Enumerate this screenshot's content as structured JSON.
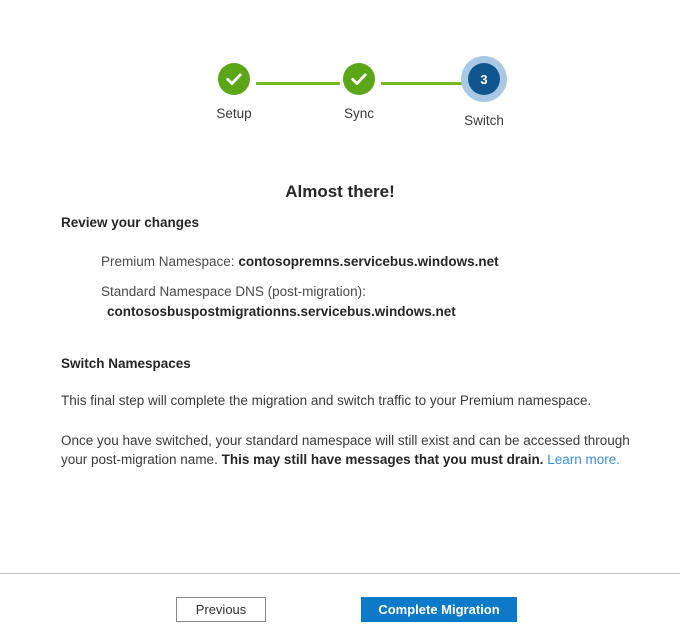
{
  "stepper": {
    "steps": [
      {
        "label": "Setup",
        "state": "done",
        "marker": "check-icon",
        "number": "1"
      },
      {
        "label": "Sync",
        "state": "done",
        "marker": "check-icon",
        "number": "2"
      },
      {
        "label": "Switch",
        "state": "current",
        "marker": "3",
        "number": "3"
      }
    ]
  },
  "main": {
    "title": "Almost there!",
    "review_heading": "Review your changes",
    "details": [
      {
        "key": "Premium Namespace:",
        "value": "contosopremns.servicebus.windows.net",
        "layout": "inline"
      },
      {
        "key": "Standard Namespace DNS (post-migration):",
        "value": "contososbuspostmigrationns.servicebus.windows.net",
        "layout": "block"
      }
    ],
    "switch_heading": "Switch Namespaces",
    "paragraph_one": "This final step will complete the migration and switch traffic to your Premium namespace.",
    "paragraph_two_prefix": "Once you have switched, your standard namespace will still exist and can be accessed through your post-migration name. ",
    "paragraph_two_bold": "This may still have messages that you must drain.",
    "paragraph_two_link": "Learn more."
  },
  "footer": {
    "previous_label": "Previous",
    "complete_label": "Complete Migration"
  },
  "colors": {
    "step_done": "#5ba617",
    "step_current": "#10558e",
    "step_current_ring": "#a8c8e4",
    "connector": "#76bc21",
    "primary_button": "#0d7ac9",
    "link": "#3b8fdd",
    "divider": "#c8c8c8"
  }
}
